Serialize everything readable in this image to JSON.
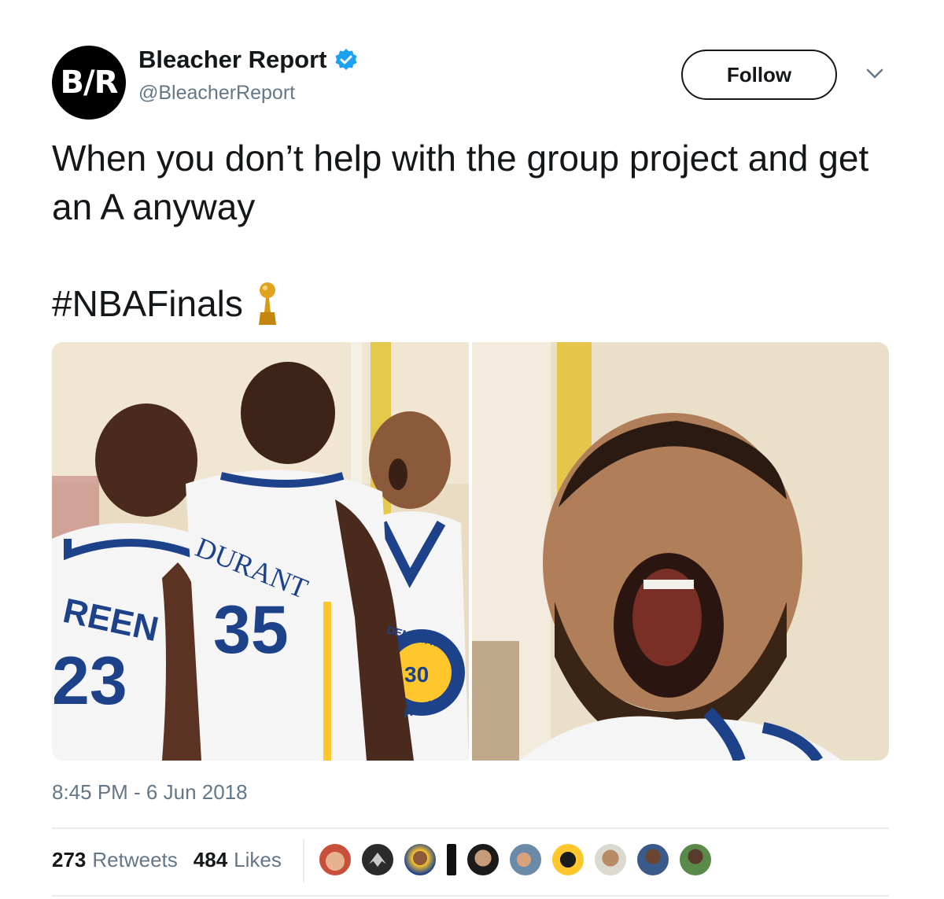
{
  "account": {
    "avatar_text": "B/R",
    "display_name": "Bleacher Report",
    "handle": "@BleacherReport",
    "verified": true
  },
  "follow_label": "Follow",
  "tweet": {
    "text": "When you don’t help with the group project and get an A anyway",
    "hashtag": "#NBAFinals",
    "hashtag_emoji": "trophy-icon"
  },
  "media": {
    "left_photo": {
      "jersey_left_name": "REEN",
      "jersey_left_number": "23",
      "jersey_center_name": "DURANT",
      "jersey_center_number": "35",
      "jersey_right_team": "DEN STATE",
      "jersey_right_number": "30",
      "jersey_right_sub": "ARRIOR"
    }
  },
  "timestamp": "8:45 PM - 6 Jun 2018",
  "stats": {
    "retweets_count": "273",
    "retweets_label": "Retweets",
    "likes_count": "484",
    "likes_label": "Likes"
  },
  "likers_count_shown": 10,
  "colors": {
    "text": "#14171a",
    "secondary": "#657786",
    "verified_blue": "#1da1f2",
    "divider": "#e6ecf0",
    "warriors_blue": "#1d428a",
    "warriors_gold": "#ffc72c"
  }
}
